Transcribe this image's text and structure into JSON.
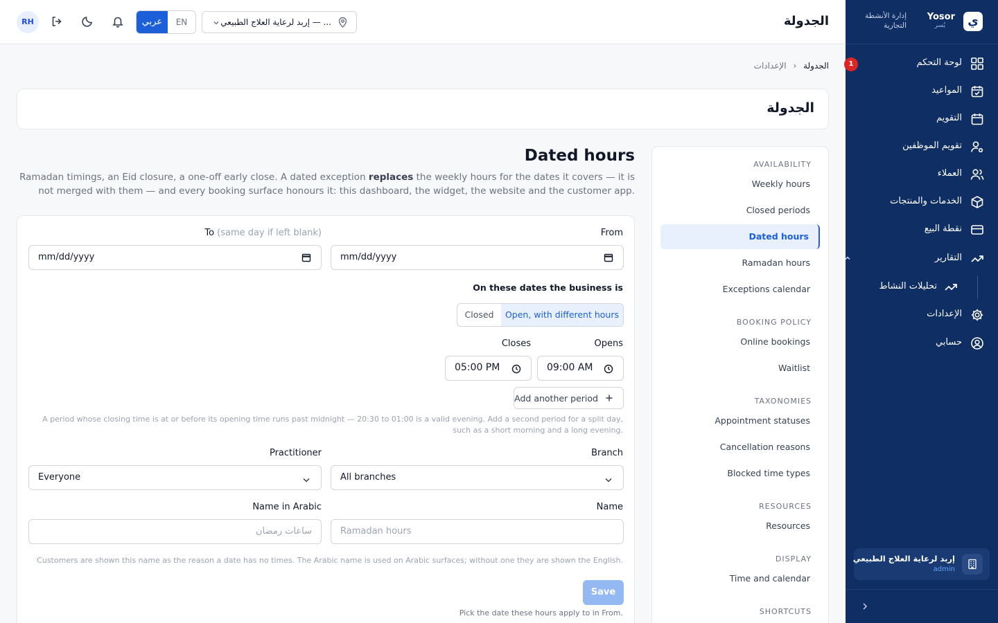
{
  "brand": {
    "name": "Yosor",
    "sub": "يُسر",
    "logo_glyph": "ي",
    "tagline": "إدارة الأنشطة التجارية"
  },
  "sidebar": {
    "items": [
      {
        "label": "لوحة التحكم",
        "icon": "grid-icon",
        "badge": "1"
      },
      {
        "label": "المواعيد",
        "icon": "calendar-check-icon"
      },
      {
        "label": "التقويم",
        "icon": "calendar-icon"
      },
      {
        "label": "تقويم الموظفين",
        "icon": "user-gear-icon"
      },
      {
        "label": "العملاء",
        "icon": "users-icon"
      },
      {
        "label": "الخدمات والمنتجات",
        "icon": "box-icon"
      },
      {
        "label": "نقطة البيع",
        "icon": "credit-card-icon"
      },
      {
        "label": "التقارير",
        "icon": "trend-icon"
      },
      {
        "label": "الإعدادات",
        "icon": "gear-icon"
      },
      {
        "label": "حسابي",
        "icon": "user-circle-icon"
      }
    ],
    "sub_item": {
      "label": "تحليلات النشاط",
      "icon": "trend-icon"
    },
    "org": {
      "name": "إربد لرعاية العلاج الطبيعي",
      "role": "admin"
    }
  },
  "topbar": {
    "title": "الجدولة",
    "avatar": "RH",
    "lang_ar": "عربي",
    "lang_en": "EN",
    "branch": "إربد لرعاية العلاج الطبيعي — ..."
  },
  "breadcrumb": {
    "parent": "الإعدادات",
    "sep": "‹",
    "current": "الجدولة"
  },
  "page_title": "الجدولة",
  "settings_nav": {
    "sections": [
      {
        "heading": "AVAILABILITY",
        "items": [
          "Weekly hours",
          "Closed periods",
          "Dated hours",
          "Ramadan hours",
          "Exceptions calendar"
        ]
      },
      {
        "heading": "BOOKING POLICY",
        "items": [
          "Online bookings",
          "Waitlist"
        ]
      },
      {
        "heading": "TAXONOMIES",
        "items": [
          "Appointment statuses",
          "Cancellation reasons",
          "Blocked time types"
        ]
      },
      {
        "heading": "RESOURCES",
        "items": [
          "Resources"
        ]
      },
      {
        "heading": "DISPLAY",
        "items": [
          "Time and calendar"
        ]
      },
      {
        "heading": "SHORTCUTS",
        "items": []
      }
    ],
    "active": "Dated hours"
  },
  "content": {
    "title": "Dated hours",
    "desc_a": "Ramadan timings, an Eid closure, a one-off early close. A dated exception",
    "desc_b": "replaces",
    "desc_c": "the weekly hours for the dates it covers — it is not merged with them — and every booking surface honours it: this dashboard, the widget, the website and the customer app."
  },
  "form": {
    "from_label": "From",
    "to_label": "To",
    "to_hint": "(same day if left blank)",
    "from_value": "mm/dd/yyyy",
    "to_value": "mm/dd/yyyy",
    "status_label": "On these dates the business is",
    "status_open": "Open, with different hours",
    "status_closed": "Closed",
    "opens_label": "Opens",
    "closes_label": "Closes",
    "opens_value": "09:00 AM",
    "closes_value": "05:00 PM",
    "add_period": "Add another period",
    "period_help": "A period whose closing time is at or before its opening time runs past midnight — 20:30 to 01:00 is a valid evening. Add a second period for a split day, such as a short morning and a long evening.",
    "branch_label": "Branch",
    "branch_value": "All branches",
    "practitioner_label": "Practitioner",
    "practitioner_value": "Everyone",
    "name_label": "Name",
    "name_placeholder": "Ramadan hours",
    "name_ar_label": "Name in Arabic",
    "name_ar_placeholder": "ساعات رمضان",
    "name_help": "Customers are shown this name as the reason a date has no times. The Arabic name is used on Arabic surfaces; without one they are shown the English.",
    "save": "Save",
    "save_help": "Pick the date these hours apply to in From."
  }
}
